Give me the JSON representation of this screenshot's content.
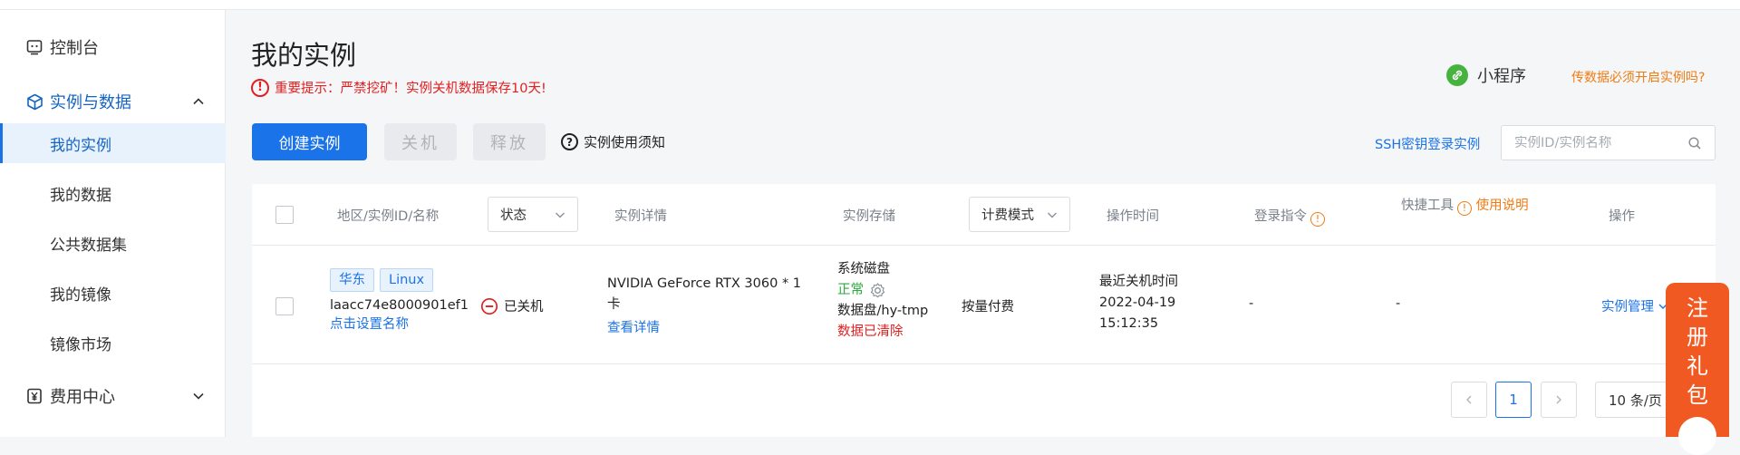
{
  "sidebar": {
    "console": "控制台",
    "group_instances": "实例与数据",
    "items": [
      {
        "label": "我的实例"
      },
      {
        "label": "我的数据"
      },
      {
        "label": "公共数据集"
      },
      {
        "label": "我的镜像"
      },
      {
        "label": "镜像市场"
      }
    ],
    "group_billing": "费用中心"
  },
  "page": {
    "title": "我的实例",
    "warning": "重要提示：严禁挖矿！实例关机数据保存10天!",
    "miniprogram": "小程序",
    "transfer_link": "传数据必须开启实例吗?"
  },
  "toolbar": {
    "create": "创建实例",
    "shutdown": "关机",
    "release": "释放",
    "notice": "实例使用须知",
    "ssh_login": "SSH密钥登录实例",
    "search_placeholder": "实例ID/实例名称"
  },
  "table": {
    "headers": {
      "region": "地区/实例ID/名称",
      "status": "状态",
      "details": "实例详情",
      "storage": "实例存储",
      "billing": "计费模式",
      "op_time": "操作时间",
      "login_cmd": "登录指令",
      "quick_tools": "快捷工具",
      "usage_guide": "使用说明",
      "actions": "操作"
    },
    "rows": [
      {
        "region_tag": "华东",
        "os_tag": "Linux",
        "instance_id": "laacc74e8000901ef1",
        "set_name": "点击设置名称",
        "status": "已关机",
        "gpu": "NVIDIA GeForce RTX 3060 * 1",
        "gpu_wrap": "卡",
        "view_details": "查看详情",
        "sys_disk": "系统磁盘",
        "sys_disk_status": "正常",
        "data_disk": "数据盘/hy-tmp",
        "data_disk_status": "数据已清除",
        "billing": "按量付费",
        "time_label": "最近关机时间",
        "time_date": "2022-04-19",
        "time_clock": "15:12:35",
        "login_cmd": "-",
        "quick_tools": "-",
        "manage": "实例管理"
      }
    ]
  },
  "pagination": {
    "current": "1",
    "page_size": "10 条/页"
  },
  "gift": [
    "注",
    "册",
    "礼",
    "包"
  ],
  "colors": {
    "primary": "#1a73e8",
    "danger": "#e02020",
    "warning": "#f07b12",
    "success": "#2bab3b",
    "gift": "#f05a22"
  }
}
